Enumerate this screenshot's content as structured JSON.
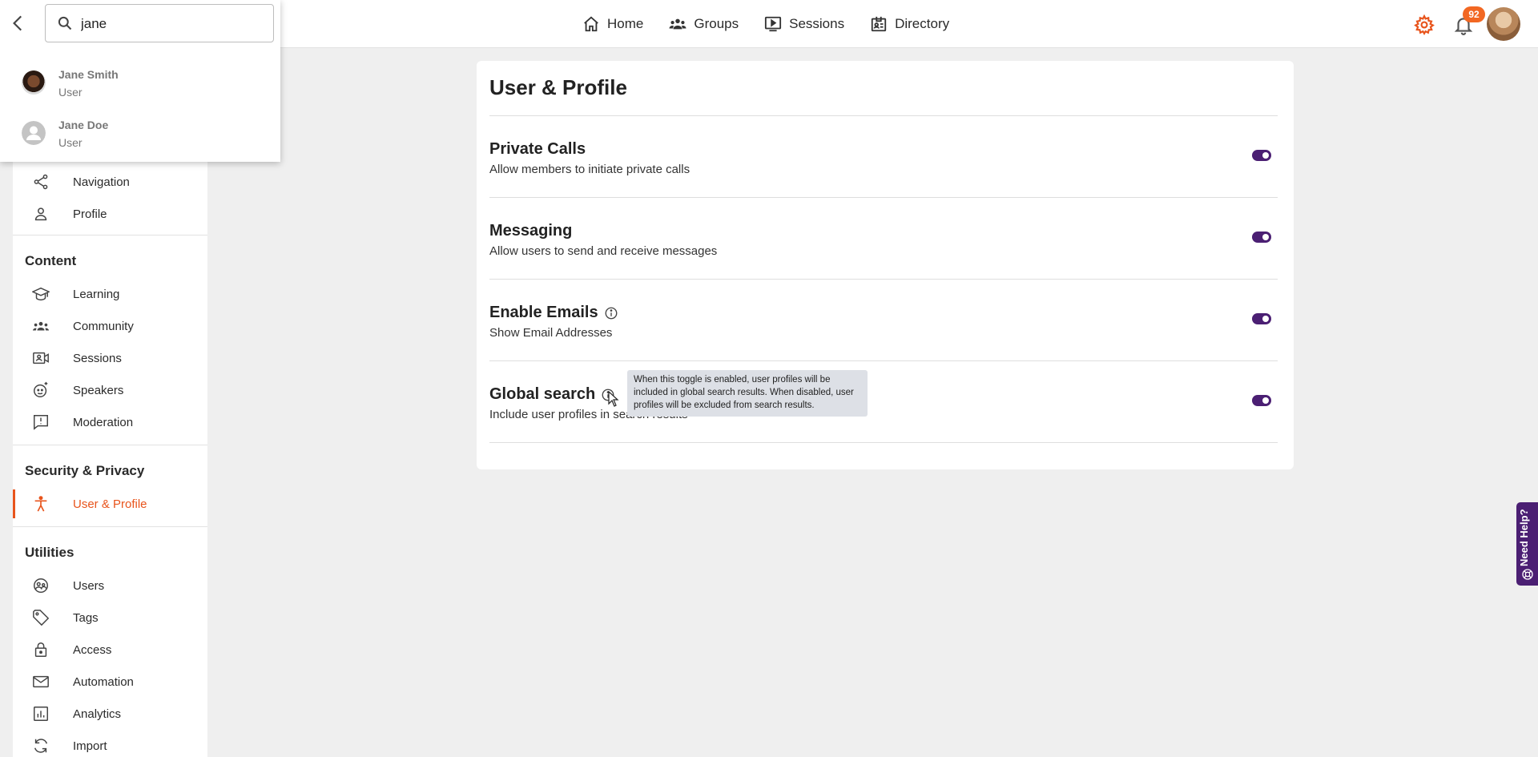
{
  "topnav": {
    "items": [
      {
        "label": "Home",
        "icon": "home-icon"
      },
      {
        "label": "Groups",
        "icon": "groups-icon"
      },
      {
        "label": "Sessions",
        "icon": "sessions-icon"
      },
      {
        "label": "Directory",
        "icon": "directory-icon"
      }
    ],
    "notification_count": "92"
  },
  "search": {
    "value": "jane",
    "results": [
      {
        "name": "Jane Smith",
        "role": "User"
      },
      {
        "name": "Jane Doe",
        "role": "User"
      }
    ]
  },
  "sidebar": {
    "items_top": [
      {
        "label": "Navigation",
        "icon": "share-icon"
      },
      {
        "label": "Profile",
        "icon": "person-icon"
      }
    ],
    "content_heading": "Content",
    "content_items": [
      {
        "label": "Learning",
        "icon": "graduation-cap-icon"
      },
      {
        "label": "Community",
        "icon": "community-icon"
      },
      {
        "label": "Sessions",
        "icon": "video-badge-icon"
      },
      {
        "label": "Speakers",
        "icon": "speaker-face-icon"
      },
      {
        "label": "Moderation",
        "icon": "moderation-icon"
      }
    ],
    "security_heading": "Security & Privacy",
    "security_items": [
      {
        "label": "User & Profile",
        "icon": "accessibility-icon",
        "active": true
      }
    ],
    "utilities_heading": "Utilities",
    "utilities_items": [
      {
        "label": "Users",
        "icon": "users-icon"
      },
      {
        "label": "Tags",
        "icon": "tag-icon"
      },
      {
        "label": "Access",
        "icon": "lock-icon"
      },
      {
        "label": "Automation",
        "icon": "mail-icon"
      },
      {
        "label": "Analytics",
        "icon": "analytics-icon"
      },
      {
        "label": "Import",
        "icon": "import-icon"
      }
    ]
  },
  "main": {
    "title": "User & Profile",
    "settings": [
      {
        "title": "Private Calls",
        "desc": "Allow members to initiate private calls",
        "enabled": true,
        "info": false
      },
      {
        "title": "Messaging",
        "desc": "Allow users to send and receive messages",
        "enabled": true,
        "info": false
      },
      {
        "title": "Enable Emails",
        "desc": "Show Email Addresses",
        "enabled": true,
        "info": true
      },
      {
        "title": "Global search",
        "desc": "Include user profiles in search results",
        "enabled": true,
        "info": true
      }
    ],
    "tooltip": "When this toggle is enabled, user profiles will be included in global search results. When disabled, user profiles will be excluded from search results."
  },
  "help": {
    "label": "Need Help?"
  },
  "colors": {
    "accent": "#e8541c",
    "toggle": "#4b1f73",
    "badge": "#f26722"
  }
}
